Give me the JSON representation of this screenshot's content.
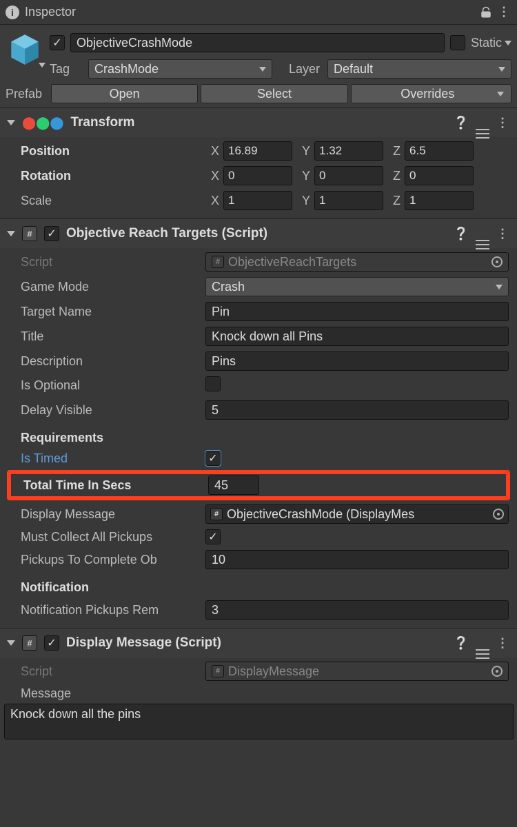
{
  "header": {
    "title": "Inspector"
  },
  "gameObject": {
    "active": true,
    "name": "ObjectiveCrashMode",
    "static_label": "Static",
    "static_checked": false,
    "tag_label": "Tag",
    "tag_value": "CrashMode",
    "layer_label": "Layer",
    "layer_value": "Default",
    "prefab_label": "Prefab",
    "open_btn": "Open",
    "select_btn": "Select",
    "overrides_btn": "Overrides"
  },
  "transform": {
    "title": "Transform",
    "position_label": "Position",
    "rotation_label": "Rotation",
    "scale_label": "Scale",
    "axis": {
      "x": "X",
      "y": "Y",
      "z": "Z"
    },
    "position": {
      "x": "16.89",
      "y": "1.32",
      "z": "6.5"
    },
    "rotation": {
      "x": "0",
      "y": "0",
      "z": "0"
    },
    "scale": {
      "x": "1",
      "y": "1",
      "z": "1"
    }
  },
  "objective": {
    "title": "Objective Reach Targets (Script)",
    "enabled": true,
    "script_label": "Script",
    "script_value": "ObjectiveReachTargets",
    "gamemode_label": "Game Mode",
    "gamemode_value": "Crash",
    "targetname_label": "Target Name",
    "targetname_value": "Pin",
    "title_label": "Title",
    "title_value": "Knock down all Pins",
    "description_label": "Description",
    "description_value": "Pins",
    "isoptional_label": "Is Optional",
    "isoptional_value": false,
    "delayvisible_label": "Delay Visible",
    "delayvisible_value": "5",
    "requirements_header": "Requirements",
    "istimed_label": "Is Timed",
    "istimed_value": true,
    "totaltime_label": "Total Time In Secs",
    "totaltime_value": "45",
    "displaymessage_label": "Display Message",
    "displaymessage_value": "ObjectiveCrashMode (DisplayMes",
    "mustcollect_label": "Must Collect All Pickups",
    "mustcollect_value": true,
    "pickupcomplete_label": "Pickups To Complete Ob",
    "pickupcomplete_value": "10",
    "notification_header": "Notification",
    "notification_pickups_label": "Notification Pickups Rem",
    "notification_pickups_value": "3"
  },
  "displayMessage": {
    "title": "Display Message (Script)",
    "enabled": true,
    "script_label": "Script",
    "script_value": "DisplayMessage",
    "message_label": "Message",
    "message_value": "Knock down all the pins"
  },
  "icons": {
    "hash": "#"
  }
}
